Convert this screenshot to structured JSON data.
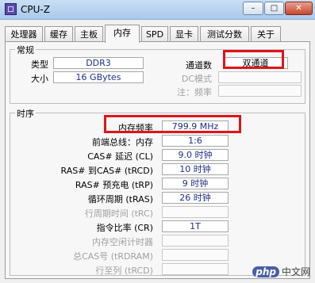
{
  "window": {
    "title": "CPU-Z",
    "controls": {
      "minimize": "–",
      "maximize": "□",
      "close": "✕"
    }
  },
  "tabs": [
    "处理器",
    "缓存",
    "主板",
    "内存",
    "SPD",
    "显卡",
    "测试分数",
    "关于"
  ],
  "active_tab": "内存",
  "general": {
    "title": "常规",
    "type_label": "类型",
    "type_value": "DDR3",
    "size_label": "大小",
    "size_value": "16 GBytes",
    "channels_label": "通道数",
    "channels_value": "双通道",
    "dc_mode_label": "DC模式",
    "note_label": "注：频率"
  },
  "timings": {
    "title": "时序",
    "rows": [
      {
        "label": "内存频率",
        "value": "799.9 MHz"
      },
      {
        "label": "前端总线：内存",
        "value": "1:6"
      },
      {
        "label": "CAS# 延迟 (CL)",
        "value": "9.0 时钟"
      },
      {
        "label": "RAS# 到CAS# (tRCD)",
        "value": "10 时钟"
      },
      {
        "label": "RAS# 预充电 (tRP)",
        "value": "9 时钟"
      },
      {
        "label": "循环周期 (tRAS)",
        "value": "26 时钟"
      },
      {
        "label": "行周期时间 (tRC)",
        "value": ""
      },
      {
        "label": "指令比率 (CR)",
        "value": "1T"
      },
      {
        "label": "内存空闲计时器",
        "value": ""
      },
      {
        "label": "总CAS号 (tRDRAM)",
        "value": ""
      },
      {
        "label": "行至列 (tRCD)",
        "value": ""
      }
    ]
  },
  "watermark": {
    "logo": "php",
    "text": "中文网"
  },
  "colors": {
    "highlight": "#e0141a",
    "value_text": "#1f2d8a"
  }
}
